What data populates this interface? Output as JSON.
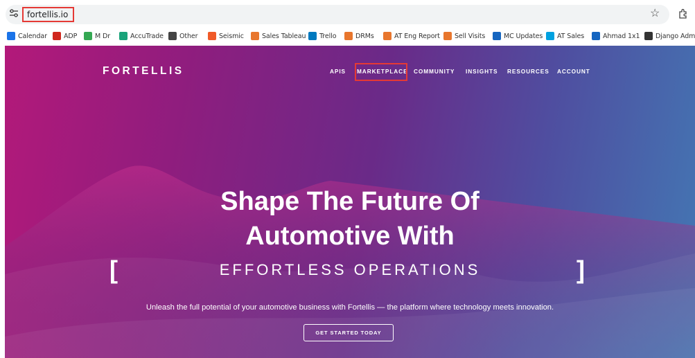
{
  "browser": {
    "url": "fortellis.io",
    "bookmarks": [
      {
        "label": "Calendar",
        "icon": "calendar-icon",
        "color": "#1a73e8"
      },
      {
        "label": "ADP",
        "icon": "adp-logo-icon",
        "color": "#d0271d"
      },
      {
        "label": "M Dr",
        "icon": "google-drive-icon",
        "color": "#34a853"
      },
      {
        "label": "AccuTrade",
        "icon": "accutrade-icon",
        "color": "#1aa37a"
      },
      {
        "label": "Other",
        "icon": "folder-icon",
        "color": "#444444"
      },
      {
        "label": "Seismic",
        "icon": "seismic-icon",
        "color": "#f05a28"
      },
      {
        "label": "Sales Tableau",
        "icon": "tableau-icon",
        "color": "#e8762d"
      },
      {
        "label": "Trello",
        "icon": "trello-icon",
        "color": "#0079bf"
      },
      {
        "label": "DRMs",
        "icon": "tableau-icon",
        "color": "#e8762d"
      },
      {
        "label": "AT Eng Report",
        "icon": "tableau-icon",
        "color": "#e8762d"
      },
      {
        "label": "Sell Visits",
        "icon": "tableau-icon",
        "color": "#e8762d"
      },
      {
        "label": "MC Updates",
        "icon": "confluence-icon",
        "color": "#1565c0"
      },
      {
        "label": "AT Sales",
        "icon": "salesforce-icon",
        "color": "#00a1e0"
      },
      {
        "label": "Ahmad 1x1",
        "icon": "confluence-icon",
        "color": "#1565c0"
      },
      {
        "label": "Django Admin",
        "icon": "globe-icon",
        "color": "#333333"
      }
    ]
  },
  "site": {
    "brand": "FORTELLIS",
    "nav": [
      "APIS",
      "MARKETPLACE",
      "COMMUNITY",
      "INSIGHTS",
      "RESOURCES",
      "ACCOUNT"
    ],
    "headline_line1": "Shape The Future Of",
    "headline_line2": "Automotive With",
    "bracket_open": "[",
    "rotating_text": "EFFORTLESS OPERATIONS",
    "bracket_close": "]",
    "tagline": "Unleash the full potential of your automotive business with Fortellis — the platform where technology meets innovation.",
    "cta": "GET STARTED TODAY"
  },
  "colors": {
    "highlight": "#e53935",
    "hero_start": "#b3197a",
    "hero_end": "#4378b4"
  }
}
